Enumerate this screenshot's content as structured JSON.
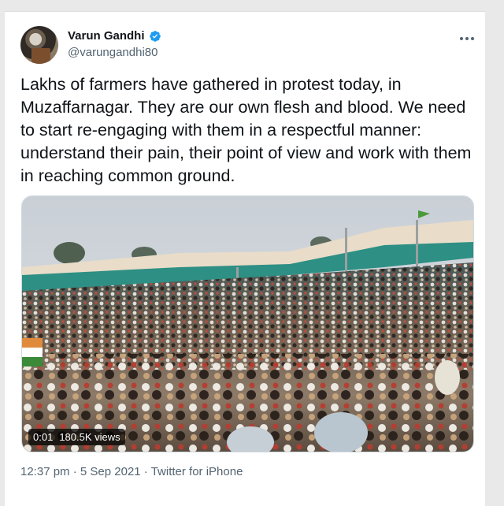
{
  "tweet": {
    "author": {
      "display_name": "Varun Gandhi",
      "handle": "@varungandhi80",
      "verified_icon": "verified-badge-icon"
    },
    "more_icon": "more-horizontal-icon",
    "text": "Lakhs of farmers have gathered in protest today, in Muzaffarnagar. They are our own flesh and blood. We need to start re-engaging with them in a respectful manner: understand their pain, their point of view and work with them in reaching common ground.",
    "video": {
      "time": "0:01",
      "views": "180.5K views"
    },
    "footer": {
      "time": "12:37 pm",
      "separator1": " · ",
      "date": "5 Sep 2021",
      "separator2": " · ",
      "source": "Twitter for iPhone"
    }
  },
  "colors": {
    "text": "#0f1419",
    "secondary": "#536471",
    "verified": "#1d9bf0"
  }
}
